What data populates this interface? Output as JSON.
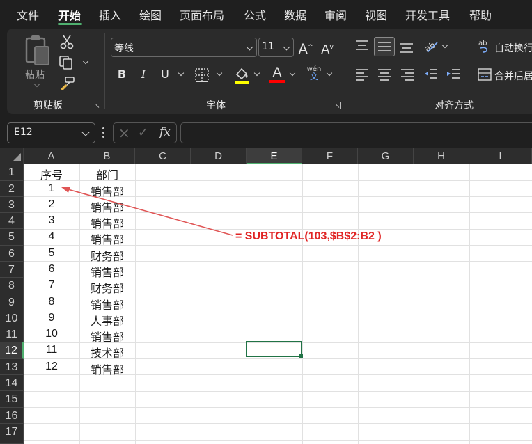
{
  "menu": {
    "items": [
      "文件",
      "开始",
      "插入",
      "绘图",
      "页面布局",
      "公式",
      "数据",
      "审阅",
      "视图",
      "开发工具",
      "帮助"
    ],
    "active_index": 1
  },
  "ribbon": {
    "clipboard": {
      "paste_label": "粘贴",
      "group_label": "剪贴板"
    },
    "font": {
      "font_name": "等线",
      "font_size": "11",
      "bold": "B",
      "italic": "I",
      "underline": "U",
      "grow": "A",
      "shrink": "A",
      "font_color": "A",
      "phonetic_top": "wén",
      "phonetic_bottom": "文",
      "group_label": "字体"
    },
    "alignment": {
      "wrap_text": "自动换行",
      "merge_center": "合并后居",
      "group_label": "对齐方式"
    },
    "colors": {
      "highlight": "#ffff00",
      "font_color": "#ff0000",
      "accent": "#4fb06f"
    }
  },
  "formula_bar": {
    "name_box": "E12",
    "cancel_icon": "×",
    "enter_icon": "✓",
    "fx_label": "fx",
    "formula": ""
  },
  "sheet": {
    "columns": [
      "A",
      "B",
      "C",
      "D",
      "E",
      "F",
      "G",
      "H",
      "I"
    ],
    "selected_column": "E",
    "rows": [
      "1",
      "2",
      "3",
      "4",
      "5",
      "6",
      "7",
      "8",
      "9",
      "10",
      "11",
      "12",
      "13",
      "14",
      "15",
      "16",
      "17"
    ],
    "selected_row": "12",
    "selected_cell": "E12",
    "data": [
      [
        "序号",
        "部门"
      ],
      [
        "1",
        "销售部"
      ],
      [
        "2",
        "销售部"
      ],
      [
        "3",
        "销售部"
      ],
      [
        "4",
        "销售部"
      ],
      [
        "5",
        "财务部"
      ],
      [
        "6",
        "销售部"
      ],
      [
        "7",
        "财务部"
      ],
      [
        "8",
        "销售部"
      ],
      [
        "9",
        "人事部"
      ],
      [
        "10",
        "销售部"
      ],
      [
        "11",
        "技术部"
      ],
      [
        "12",
        "销售部"
      ]
    ],
    "annotation": "=  SUBTOTAL(103,$B$2:B2 )",
    "annotation_color": "#e02424"
  }
}
